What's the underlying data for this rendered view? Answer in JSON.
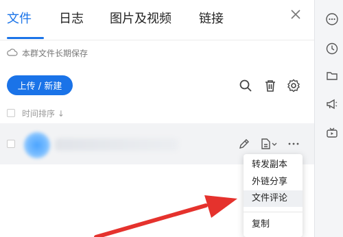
{
  "tabs": [
    {
      "label": "文件",
      "active": true
    },
    {
      "label": "日志"
    },
    {
      "label": "图片及视频"
    },
    {
      "label": "链接"
    }
  ],
  "close_icon": "close-icon",
  "notice": {
    "icon": "cloud-icon",
    "text": "本群文件长期保存"
  },
  "upload_button": {
    "label": "上传 / 新建",
    "color": "#1a73e8"
  },
  "toolbar_icons": [
    "search-icon",
    "trash-icon",
    "gear-icon"
  ],
  "sort": {
    "label": "时间排序",
    "arrow": "↓"
  },
  "file_row": {
    "name_blurred": true,
    "icons": [
      "edit-icon",
      "doc-dropdown-icon",
      "more-icon"
    ]
  },
  "context_menu": {
    "items": [
      {
        "label": "转发副本"
      },
      {
        "label": "外链分享"
      },
      {
        "label": "文件评论",
        "highlighted": true
      },
      {
        "label": "复制"
      }
    ]
  },
  "right_rail_icons": [
    "more-circle-icon",
    "clock-icon",
    "folder-icon",
    "megaphone-icon",
    "tv-icon"
  ],
  "colors": {
    "accent": "#1a73e8",
    "arrow": "#e5322d"
  }
}
